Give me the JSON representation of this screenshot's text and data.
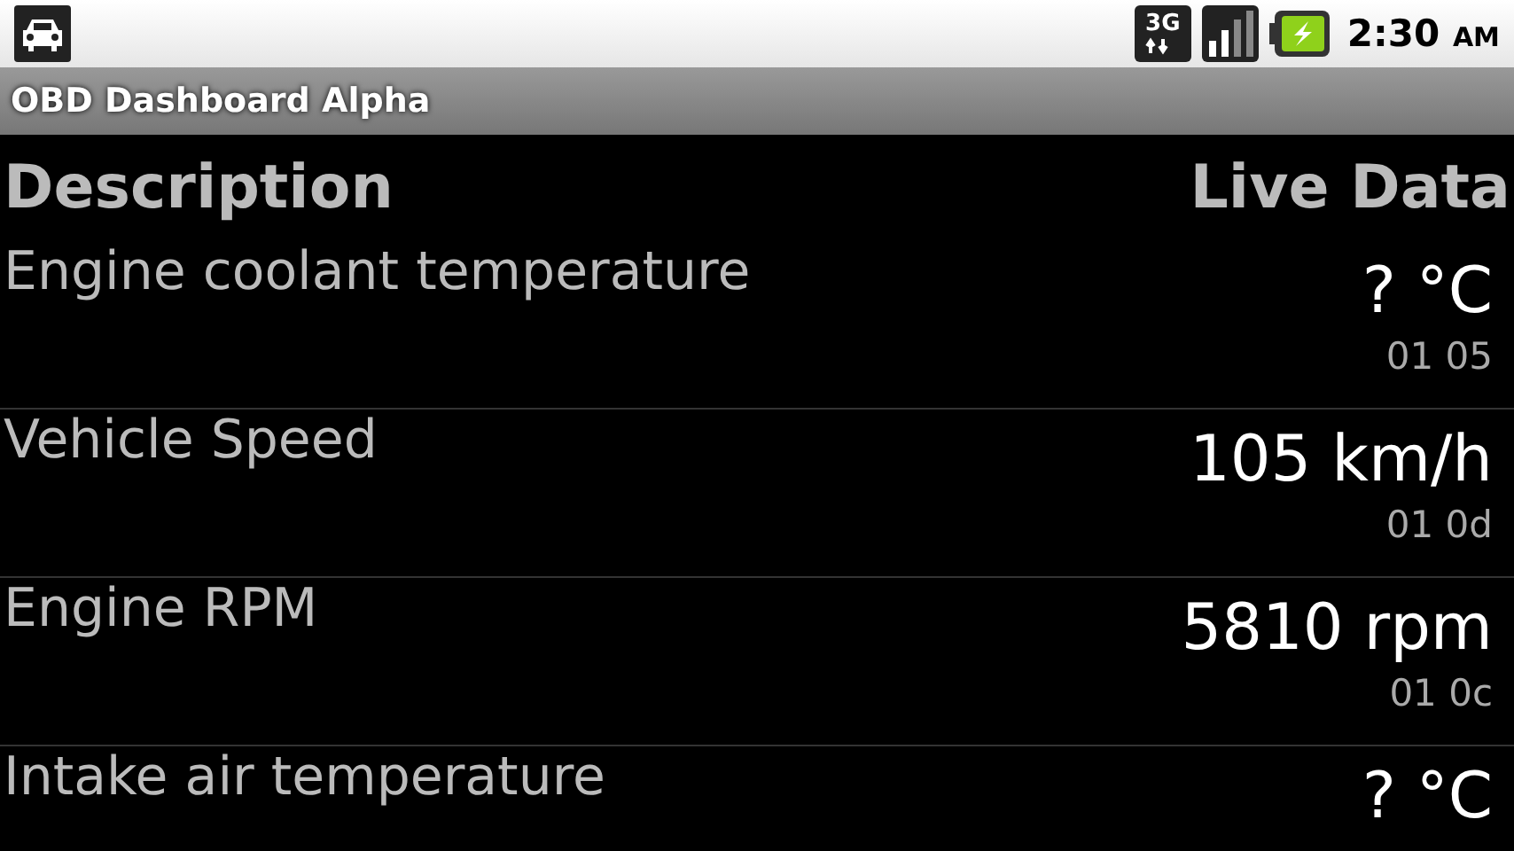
{
  "status_bar": {
    "network_label": "3G",
    "time": "2:30",
    "time_suffix": "AM"
  },
  "title_bar": {
    "title": "OBD Dashboard Alpha"
  },
  "table": {
    "columns": [
      "Description",
      "Live Data"
    ],
    "rows": [
      {
        "description": "Engine coolant temperature",
        "value": "? °C",
        "pid": "01 05"
      },
      {
        "description": "Vehicle Speed",
        "value": "105 km/h",
        "pid": "01 0d"
      },
      {
        "description": "Engine RPM",
        "value": "5810 rpm",
        "pid": "01 0c"
      },
      {
        "description": "Intake air temperature",
        "value": "? °C"
      }
    ]
  }
}
